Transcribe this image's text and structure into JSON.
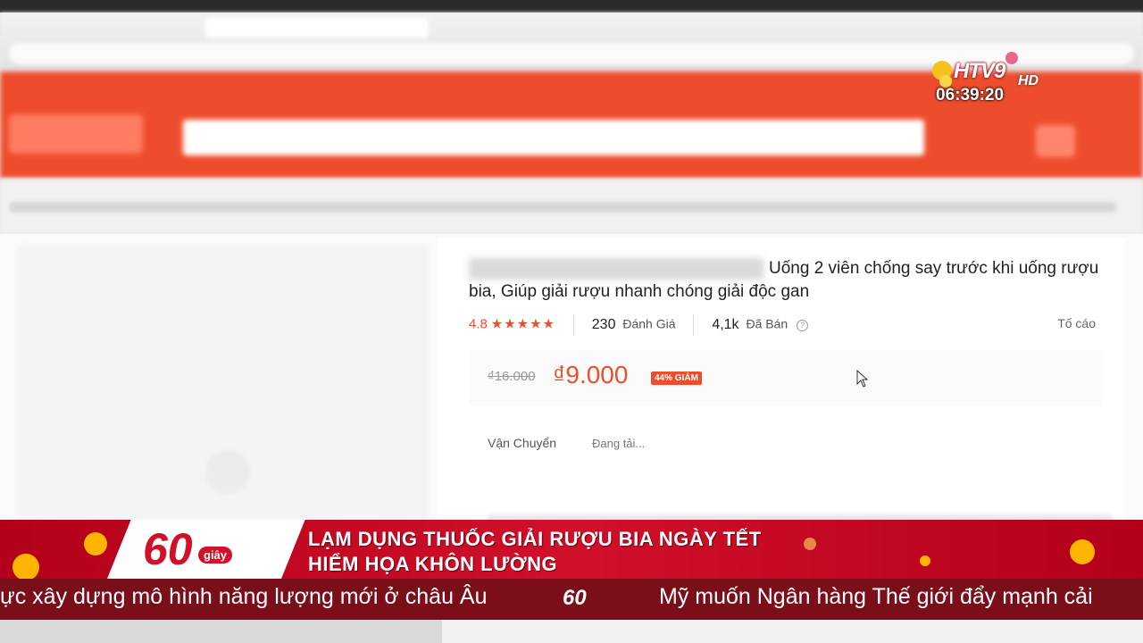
{
  "broadcast": {
    "channel_logo": "HTV9",
    "hd_badge": "HD",
    "clock": "06:39:20",
    "program_logo_number": "60",
    "program_logo_word": "giây",
    "headline_line1": "LẠM DỤNG THUỐC GIẢI RƯỢU BIA NGÀY TẾT",
    "headline_line2": "HIỂM HỌA KHÔN LƯỜNG",
    "ticker_left": "ực xây dựng mô hình năng lượng mới ở châu Âu",
    "ticker_logo": "60",
    "ticker_right": "Mỹ muốn Ngân hàng Thế giới đẩy mạnh cải"
  },
  "product": {
    "title": "Uống 2 viên chống say trước khi uống rượu bia, Giúp giải rượu nhanh chóng giải độc gan",
    "rating_value": "4.8",
    "stars": "★★★★★",
    "review_count": "230",
    "review_label": "Đánh Giá",
    "sold_count": "4,1k",
    "sold_label": "Đã Bán",
    "help_icon": "?",
    "report_label": "Tố cáo",
    "old_price": "₫16.000",
    "price": "₫9.000",
    "discount_badge": "44% GIẢM",
    "shipping_label": "Vận Chuyển",
    "shipping_value": "Đang tải..."
  },
  "colors": {
    "shopee_orange": "#ee4d2d",
    "lower_third_red": "#d1102a",
    "ticker_bg": "#7a0f1a"
  }
}
